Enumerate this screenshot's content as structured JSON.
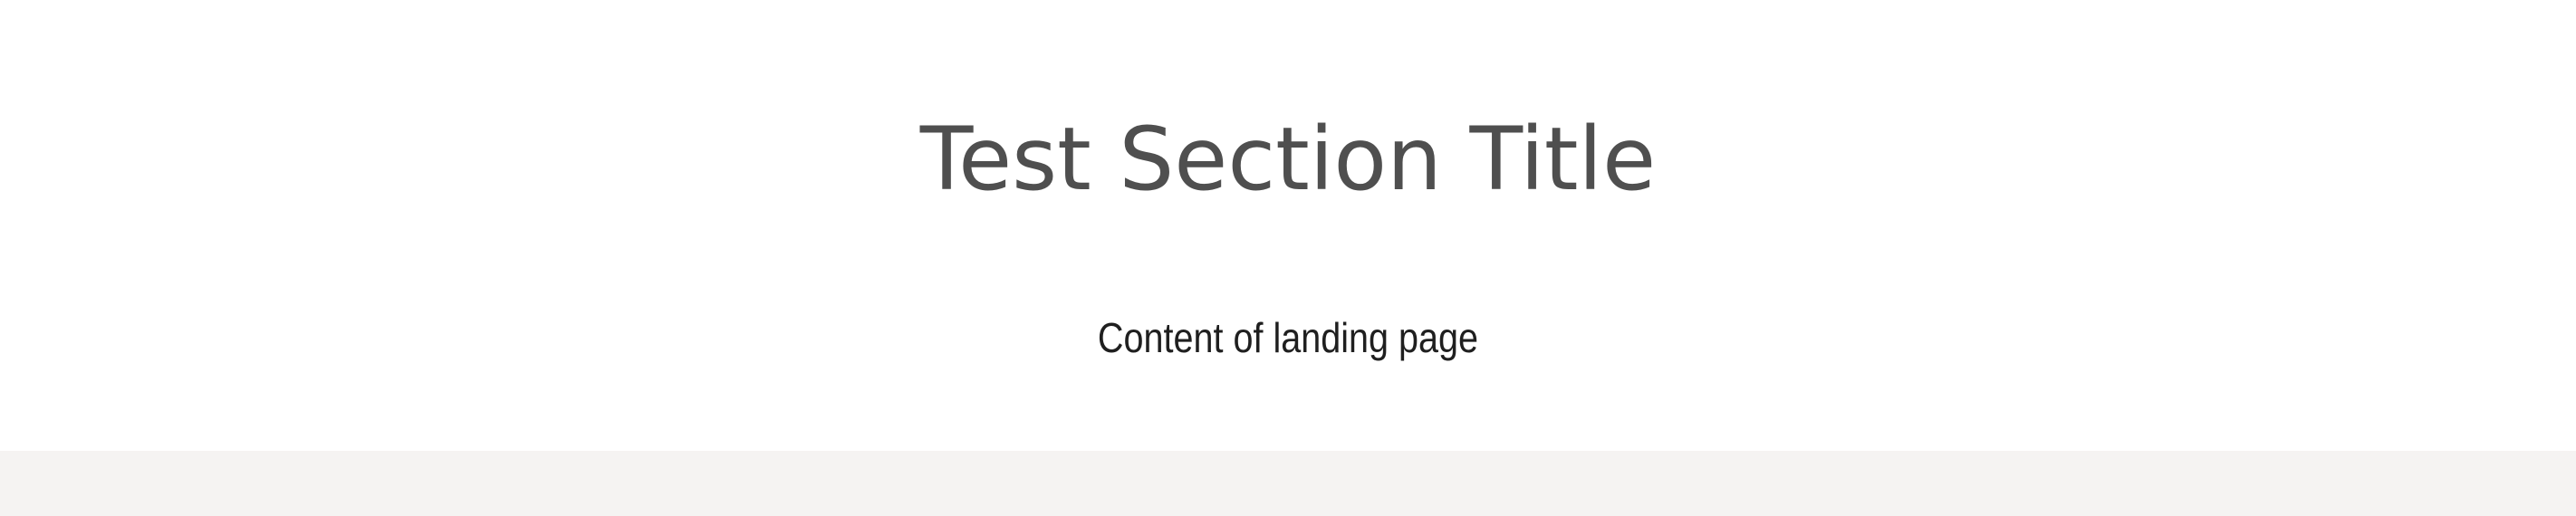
{
  "section": {
    "title": "Test Section Title",
    "content": "Content of landing page"
  },
  "colors": {
    "background": "#ffffff",
    "title_text": "#4f4f4f",
    "content_text": "#1f1f1f",
    "footer_band": "#f5f3f2"
  }
}
